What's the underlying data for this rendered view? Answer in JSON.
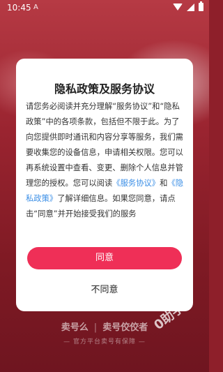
{
  "statusbar": {
    "time": "10:45",
    "sim_label": "A"
  },
  "dialog": {
    "title": "隐私政策及服务协议",
    "body_pre": "请您务必阅读并充分理解“服务协议”和“隐私政策”中的各项条款，包括但不限于此。为了向您提供即时通讯和内容分享等服务，我们需要收集您的设备信息，申请相关权限。您可以再系统设置中查看、变更、删除个人信息并管理您的授权。您可以阅读",
    "link_service": "《服务协议》",
    "and_text": "和",
    "link_privacy": "《隐私政策》",
    "body_post": "了解详细信息。如果您同意，请点击“同意”并开始接受我们的服务",
    "agree_label": "同意",
    "disagree_label": "不同意"
  },
  "footer": {
    "brand_left": "卖号么",
    "brand_sep": "|",
    "brand_right": "卖号佼佼者",
    "tagline": "— 官方平台卖号有保障 —"
  },
  "watermark": {
    "text": "0助手"
  },
  "colors": {
    "accent": "#ef2f57",
    "link": "#3a8ee6",
    "background": "#8e1f2a"
  }
}
